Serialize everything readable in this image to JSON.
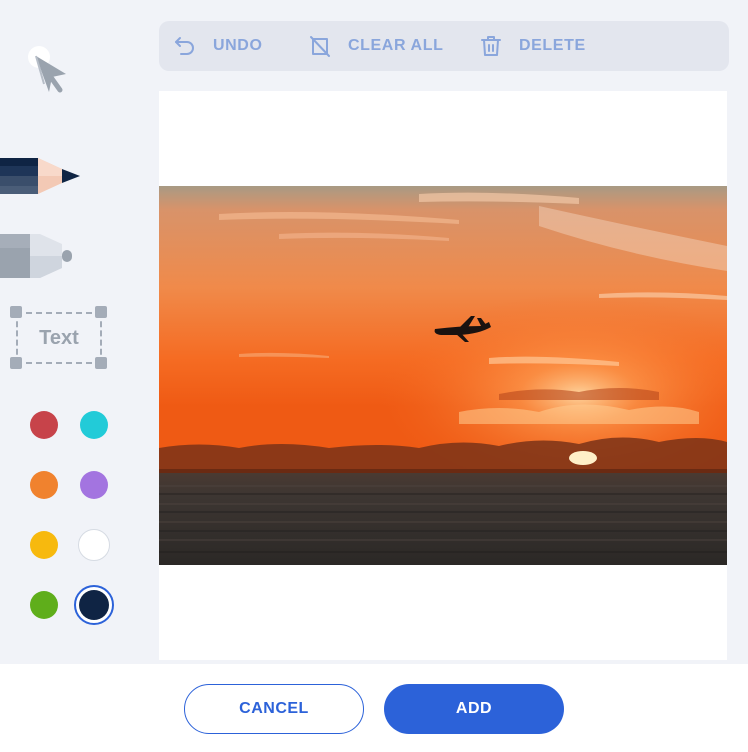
{
  "tools": {
    "select_icon": "cursor-icon",
    "pencil_icon": "pencil-icon",
    "marker_icon": "marker-icon",
    "text_label": "Text"
  },
  "toolbar": {
    "undo_label": "UNDO",
    "clear_all_label": "CLEAR ALL",
    "delete_label": "DELETE"
  },
  "colors": {
    "palette": [
      "#c7434a",
      "#22cbd8",
      "#f0822e",
      "#a374e0",
      "#f7b90e",
      "#ffffff",
      "#5fae1b",
      "#0f2444"
    ],
    "selected": "#0f2444",
    "accent": "#2c62d9",
    "toolbar_text": "#8aa6dc"
  },
  "footer": {
    "cancel_label": "CANCEL",
    "add_label": "ADD"
  }
}
